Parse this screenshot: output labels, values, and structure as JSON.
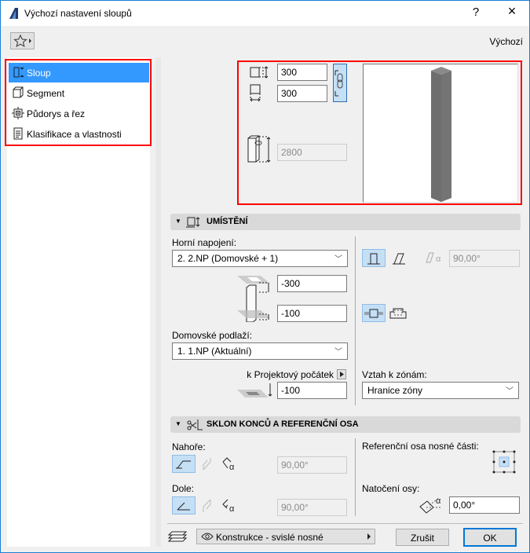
{
  "window": {
    "title": "Výchozí nastavení sloupů",
    "help": "?",
    "close": "×"
  },
  "toolbar": {
    "favorites_icon": "star-icon",
    "preset_label": "Výchozí"
  },
  "sidebar": {
    "items": [
      {
        "label": "Sloup",
        "icon": "column-icon",
        "selected": true
      },
      {
        "label": "Segment",
        "icon": "segment-icon"
      },
      {
        "label": "Půdorys a řez",
        "icon": "floorplan-icon"
      },
      {
        "label": "Klasifikace a vlastnosti",
        "icon": "list-icon"
      }
    ]
  },
  "preview": {
    "width": "300",
    "depth": "300",
    "height": "2800"
  },
  "placement": {
    "title": "UMÍSTĚNÍ",
    "top_link_label": "Horní napojení:",
    "top_link_value": "2. 2.NP (Domovské + 1)",
    "top_offset": "-300",
    "bottom_offset": "-100",
    "home_story_label": "Domovské podlaží:",
    "home_story_value": "1. 1.NP (Aktuální)",
    "reference_label": "k Projektový počátek",
    "reference_value": "-100",
    "tilt_angle": "90,00°",
    "zone_label": "Vztah k zónám:",
    "zone_value": "Hranice zóny"
  },
  "ends": {
    "title": "SKLON KONCŮ A REFERENČNÍ OSA",
    "top_label": "Nahoře:",
    "top_angle": "90,00°",
    "bottom_label": "Dole:",
    "bottom_angle": "90,00°",
    "ref_axis_label": "Referenční osa nosné části:",
    "rotation_label": "Natočení osy:",
    "rotation_value": "0,00°"
  },
  "footer": {
    "layer": "Konstrukce - svislé nosné",
    "cancel": "Zrušit",
    "ok": "OK"
  }
}
